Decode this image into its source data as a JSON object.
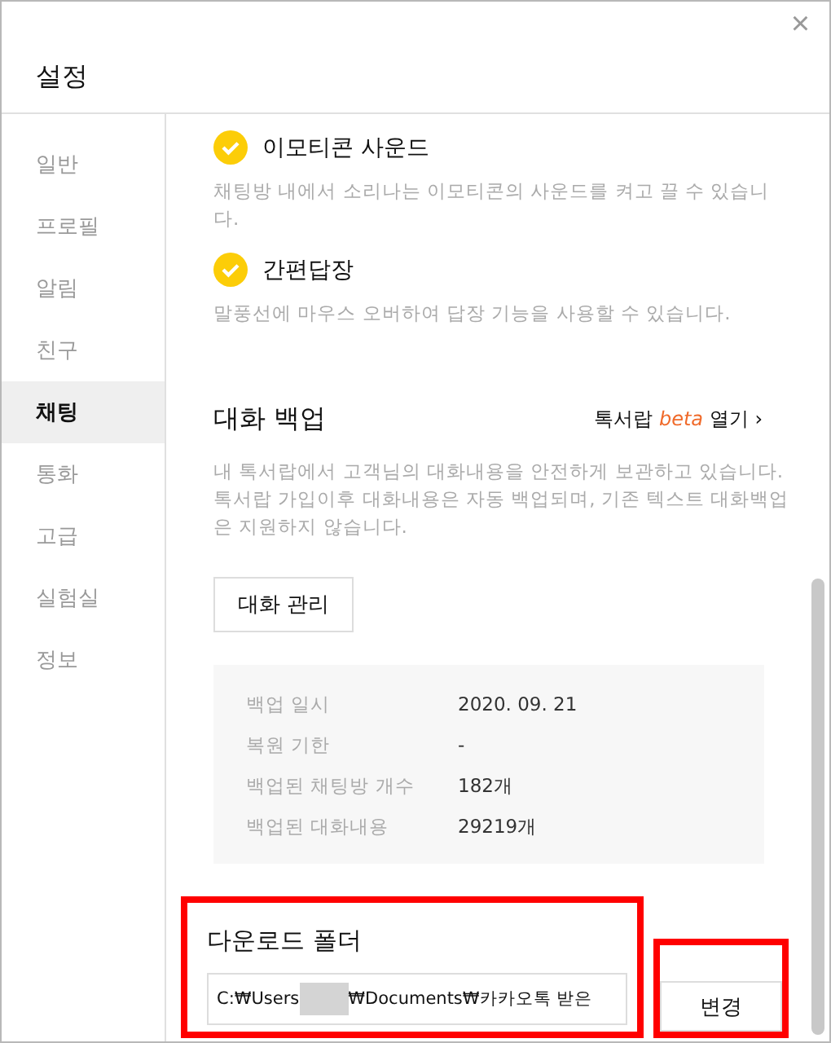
{
  "window": {
    "title": "설정",
    "close": "×"
  },
  "sidebar": {
    "items": [
      {
        "label": "일반",
        "selected": false
      },
      {
        "label": "프로필",
        "selected": false
      },
      {
        "label": "알림",
        "selected": false
      },
      {
        "label": "친구",
        "selected": false
      },
      {
        "label": "채팅",
        "selected": true
      },
      {
        "label": "통화",
        "selected": false
      },
      {
        "label": "고급",
        "selected": false
      },
      {
        "label": "실험실",
        "selected": false
      },
      {
        "label": "정보",
        "selected": false
      }
    ]
  },
  "options": [
    {
      "label": "이모티콘 사운드",
      "checked": true,
      "description": "채팅방 내에서 소리나는 이모티콘의 사운드를 켜고 끌 수 있습니다."
    },
    {
      "label": "간편답장",
      "checked": true,
      "description": "말풍선에 마우스 오버하여 답장 기능을 사용할 수 있습니다."
    }
  ],
  "backup": {
    "title": "대화 백업",
    "link": {
      "before": "톡서랍",
      "beta": "beta",
      "after": "열기",
      "arrow": "›"
    },
    "description": "내 톡서랍에서 고객님의 대화내용을 안전하게 보관하고 있습니다. 톡서랍 가입이후 대화내용은 자동 백업되며, 기존 텍스트 대화백업은 지원하지 않습니다.",
    "manage_button": "대화 관리",
    "info": [
      {
        "label": "백업 일시",
        "value": "2020. 09. 21"
      },
      {
        "label": "복원 기한",
        "value": "-"
      },
      {
        "label": "백업된 채팅방 개수",
        "value": "182개"
      },
      {
        "label": "백업된 대화내용",
        "value": "29219개"
      }
    ]
  },
  "download": {
    "title": "다운로드 폴더",
    "path_start": "C:₩Users",
    "path_end": "₩Documents₩카카오톡 받은",
    "change_button": "변경",
    "highlighted": true,
    "button_highlighted": true
  }
}
